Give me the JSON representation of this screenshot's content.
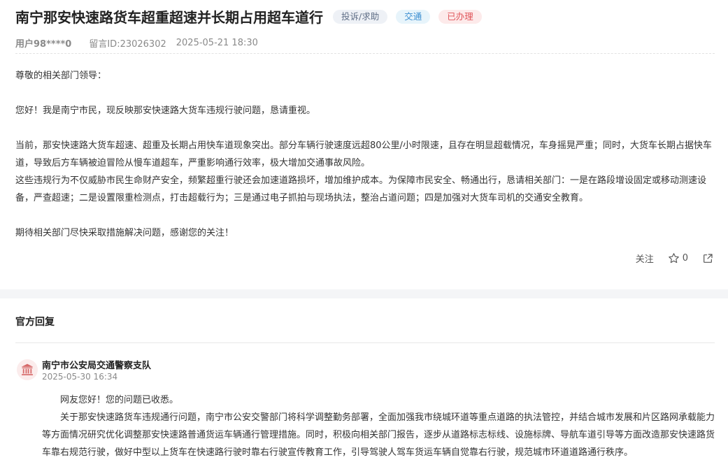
{
  "post": {
    "title": "南宁那安快速路货车超重超速并长期占用超车道行",
    "tags": {
      "type": "投诉/求助",
      "category": "交通",
      "status": "已办理"
    },
    "meta": {
      "user": "用户98****0",
      "message_id": "留言ID:23026302",
      "datetime": "2025-05-21 18:30"
    },
    "body": {
      "salutation": "尊敬的相关部门领导：",
      "intro": "您好！我是南宁市民，现反映那安快速路大货车违规行驶问题，恳请重视。",
      "para1": "当前，那安快速路大货车超速、超重及长期占用快车道现象突出。部分车辆行驶速度远超80公里/小时限速，且存在明显超载情况，车身摇晃严重；同时，大货车长期占据快车道，导致后方车辆被迫冒险从慢车道超车，严重影响通行效率，极大增加交通事故风险。",
      "para2": "这些违规行为不仅威胁市民生命财产安全，频繁超重行驶还会加速道路损坏，增加维护成本。为保障市民安全、畅通出行，恳请相关部门：一是在路段增设固定或移动测速设备，严查超速；二是设置限重检测点，打击超载行为；三是通过电子抓拍与现场执法，整治占道问题；四是加强对大货车司机的交通安全教育。",
      "closing": "期待相关部门尽快采取措施解决问题，感谢您的关注！"
    },
    "actions": {
      "follow_label": "关注",
      "like_count": "0"
    }
  },
  "official_reply": {
    "section_title": "官方回复",
    "org_name": "南宁市公安局交通警察支队",
    "datetime": "2025-05-30 16:34",
    "greeting": "网友您好！您的问题已收悉。",
    "content": "关于那安快速路货车违规通行问题，南宁市公安交警部门将科学调整勤务部署，全面加强我市绕城环道等重点道路的执法管控，并结合城市发展和片区路网承载能力等方面情况研究优化调整那安快速路普通货运车辆通行管理措施。同时，积极向相关部门报告，逐步从道路标志标线、设施标牌、导航车道引导等方面改造那安快速路货车靠右规范行驶，做好中型以上货车在快速路行驶时靠右行驶宣传教育工作，引导驾驶人驾车货运车辆自觉靠右行驶，规范城市环道道路通行秩序。"
  },
  "colors": {
    "tag_type_bg": "#eef1f6",
    "tag_category_bg": "#e7f4fb",
    "tag_status_bg": "#fdeaea",
    "status_red": "#e0555a",
    "category_blue": "#3b8ed0"
  },
  "icons": {
    "like": "star-outline-icon",
    "share": "share-icon",
    "org": "government-building-icon"
  }
}
